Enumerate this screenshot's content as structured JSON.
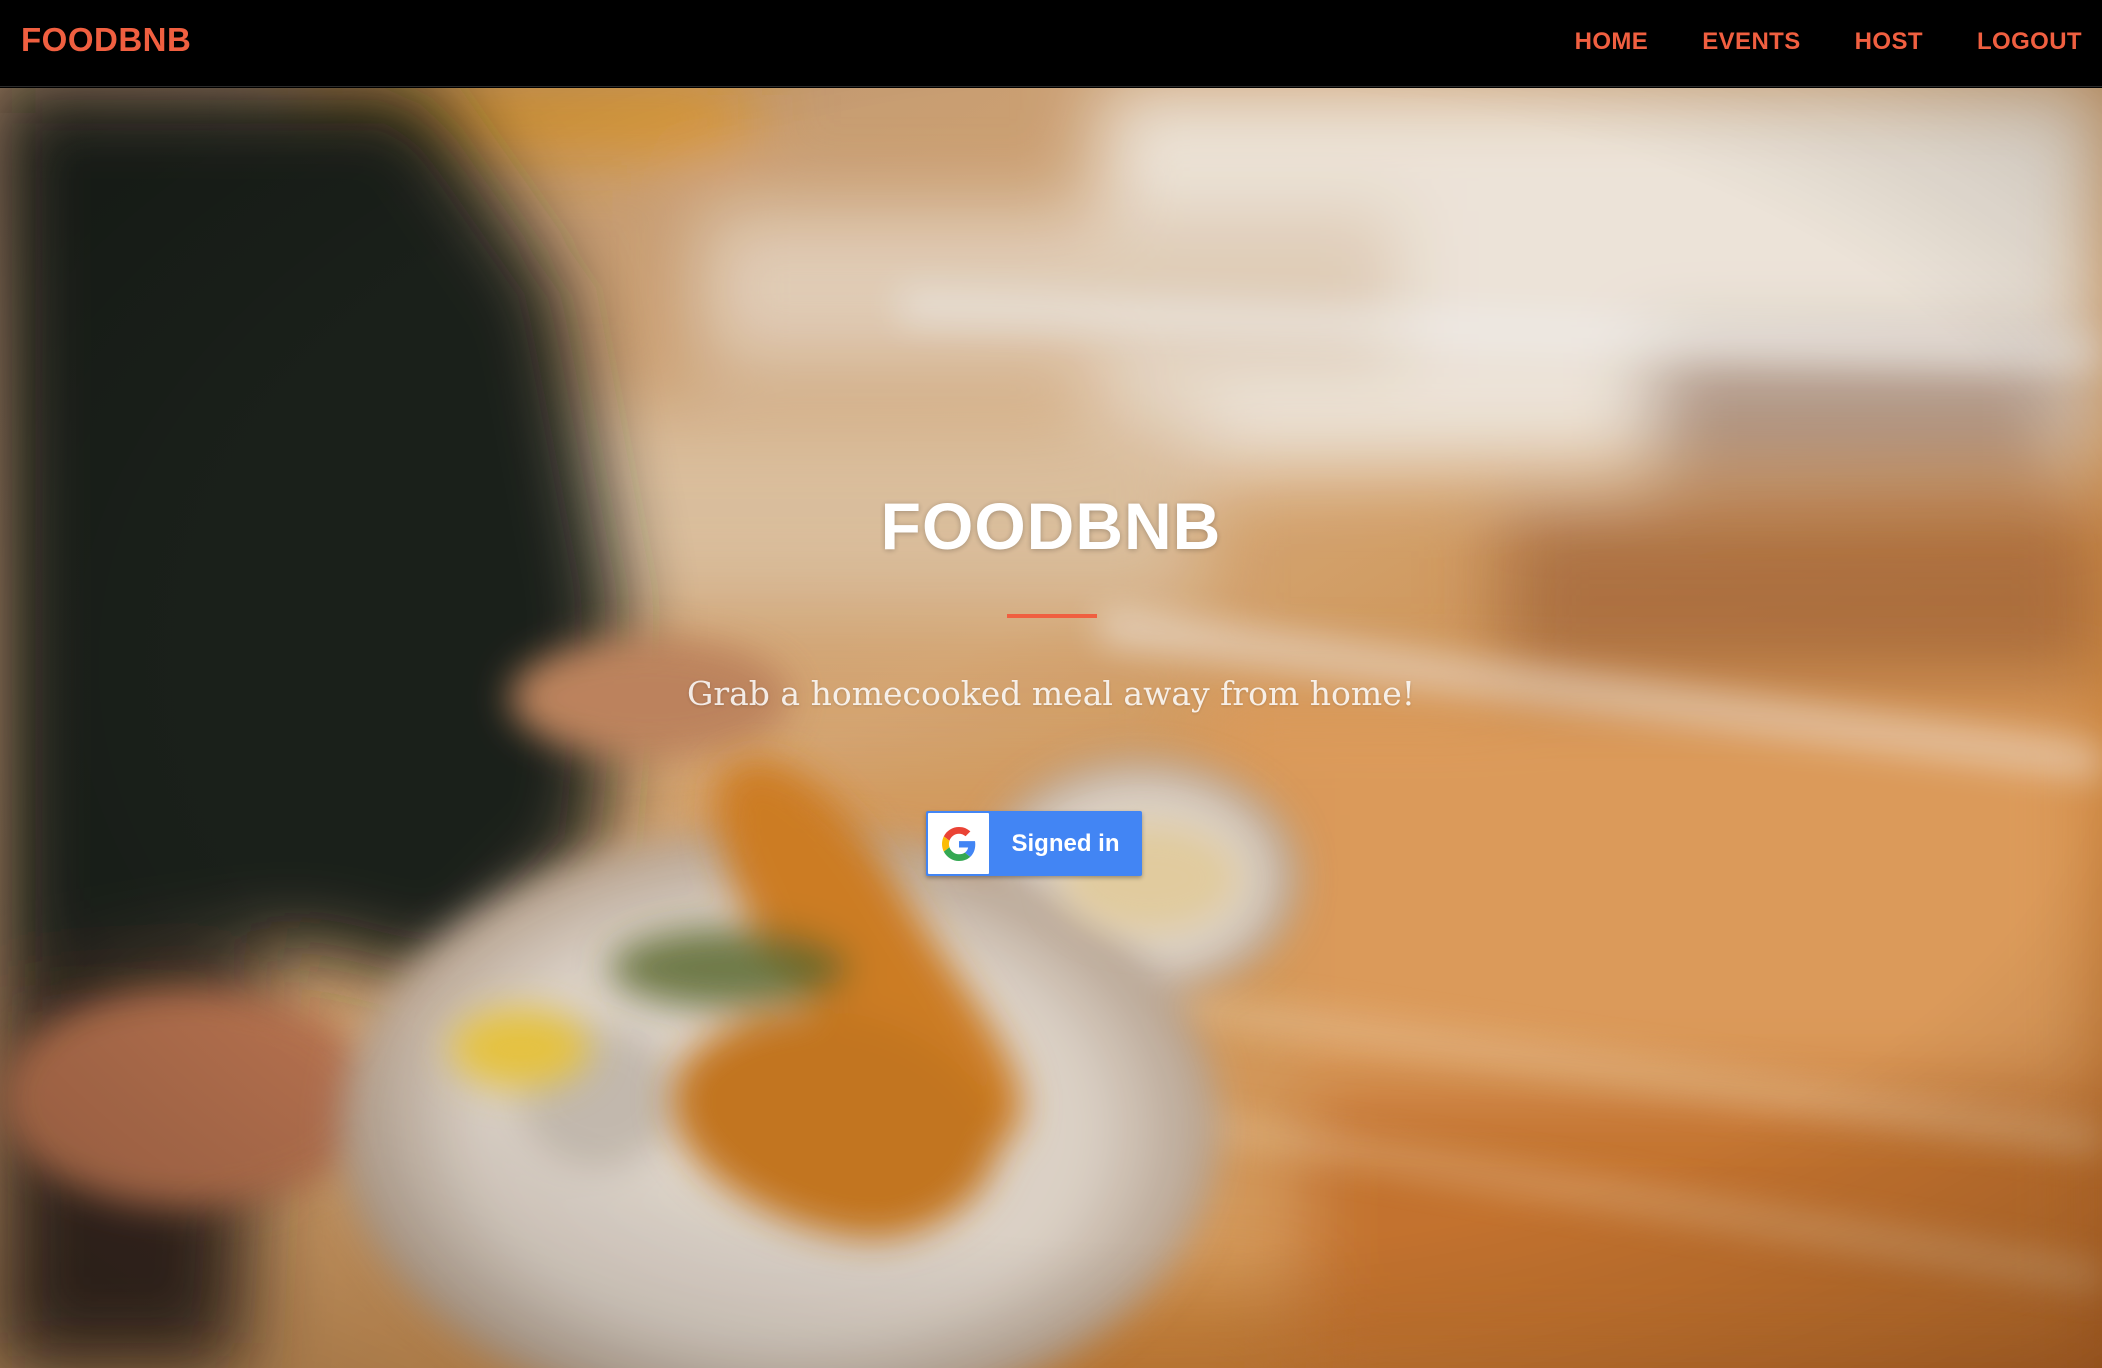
{
  "navbar": {
    "brand": "FOODBNB",
    "links": [
      "HOME",
      "EVENTS",
      "HOST",
      "LOGOUT"
    ],
    "link_color": "#f05f40",
    "background": "#000000"
  },
  "hero": {
    "title": "FOODBNB",
    "subtitle": "Grab a homecooked meal away from home!",
    "divider_color": "#f05f40",
    "background_image": "blurred restaurant photo of a server carrying plates of fish and chips"
  },
  "google_signin": {
    "label": "Signed in",
    "icon": "google-g-icon",
    "color": "#4285f4"
  }
}
